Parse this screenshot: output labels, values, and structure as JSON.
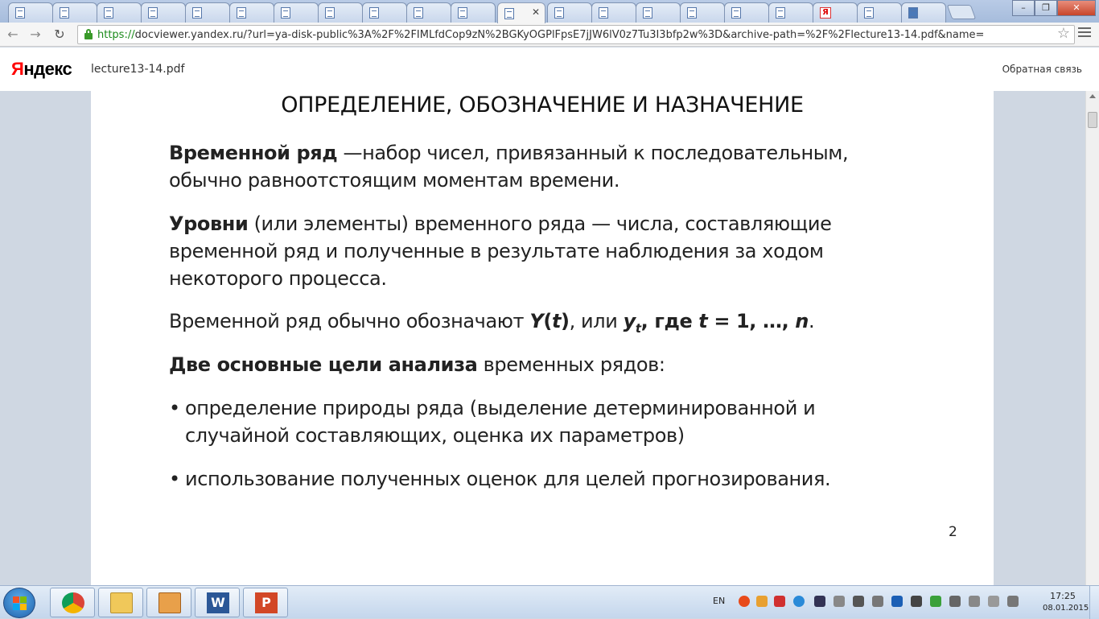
{
  "browser": {
    "url_scheme": "https://",
    "url_rest": "docviewer.yandex.ru/?url=ya-disk-public%3A%2F%2FIMLfdCop9zN%2BGKyOGPlFpsE7jJW6lV0z7Tu3I3bfp2w%3D&archive-path=%2F%2Flecture13-14.pdf&name="
  },
  "header": {
    "logo_first": "Я",
    "logo_rest": "ндекс",
    "file_name": "lecture13-14.pdf",
    "feedback": "Обратная связь"
  },
  "slide": {
    "title": "ОПРЕДЕЛЕНИЕ, ОБОЗНАЧЕНИЕ И НАЗНАЧЕНИЕ",
    "p1_bold": "Временной ряд",
    "p1_line1": " —набор чисел, привязанный к последовательным,",
    "p1_line2": "обычно равноотстоящим моментам времени.",
    "p2_bold": "Уровни",
    "p2_line1": " (или элементы) временного ряда — числа, составляющие",
    "p2_line2": "временной ряд и полученные в результате наблюдения за ходом",
    "p2_line3": "некоторого процесса.",
    "p3_prefix": "Временной ряд обычно обозначают ",
    "p3_Y": "Y",
    "p3_paren_open": "(",
    "p3_t": "t",
    "p3_paren_close": ")",
    "p3_or": ", или ",
    "p3_y": "y",
    "p3_sub": "t",
    "p3_where": ", где ",
    "p3_t2": "t",
    "p3_eq": " = 1, …, ",
    "p3_n": "n",
    "p3_dot": ".",
    "p4_bold": "Две основные цели анализа",
    "p4_rest": " временных рядов:",
    "bullet_char": "•",
    "b1_line1": "определение природы ряда (выделение детерминированной и",
    "b1_line2": "случайной составляющих, оценка их параметров)",
    "b2_line1": "использование полученных оценок для целей прогнозирования.",
    "page_number": "2"
  },
  "taskbar": {
    "lang": "EN",
    "time": "17:25",
    "date": "08.01.2015"
  },
  "colors": {
    "accent_green": "#1a8a1a",
    "yandex_red": "#ff0000"
  }
}
